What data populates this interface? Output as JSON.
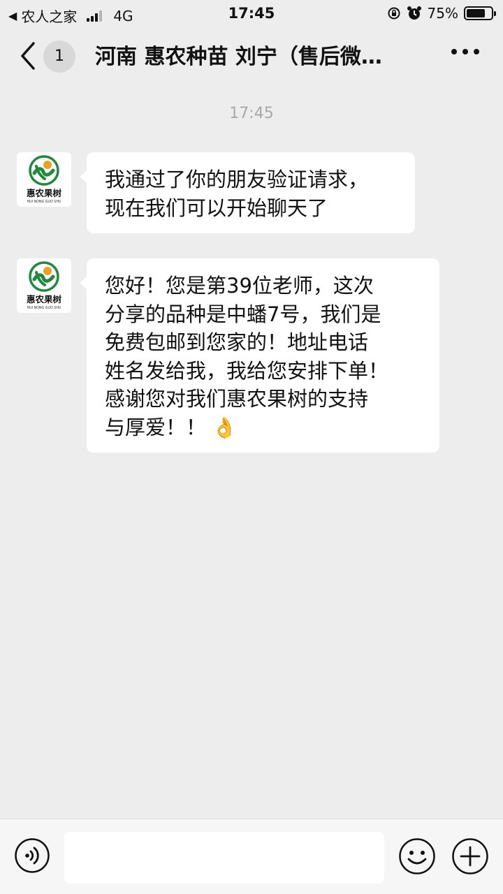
{
  "status_bar": {
    "carrier_back": "◀",
    "carrier": "农人之家",
    "network": "4G",
    "time": "17:45",
    "battery": "75%",
    "battery_level": 0.75
  },
  "nav": {
    "back_icon": "chevron-left-icon",
    "unread_count": "1",
    "title": "河南 惠农种苗 刘宁（售后微…",
    "more_icon": "ellipsis-icon"
  },
  "chat": {
    "timestamp": "17:45",
    "messages": [
      {
        "sender_avatar_text": "惠农果树",
        "sender_avatar_subtext": "HUI NONG GUO SHU",
        "lines": [
          "我通过了你的朋友验证请求，",
          "现在我们可以开始聊天了"
        ]
      },
      {
        "sender_avatar_text": "惠农果树",
        "sender_avatar_subtext": "HUI NONG GUO SHU",
        "lines": [
          "您好！您是第39位老师，这次",
          "分享的品种是中蟠7号，我们是",
          "免费包邮到您家的！地址电话",
          "姓名发给我，我给您安排下单！",
          "感谢您对我们惠农果树的支持",
          "与厚爱！！"
        ],
        "emoji": "👌"
      }
    ]
  },
  "input_bar": {
    "voice_icon": "voice-icon",
    "message_value": "",
    "emoji_icon": "emoji-icon",
    "plus_icon": "plus-icon"
  },
  "colors": {
    "background": "#ededed",
    "bubble": "#ffffff",
    "logo_green": "#1f8a3c",
    "logo_orange": "#f0a020"
  }
}
